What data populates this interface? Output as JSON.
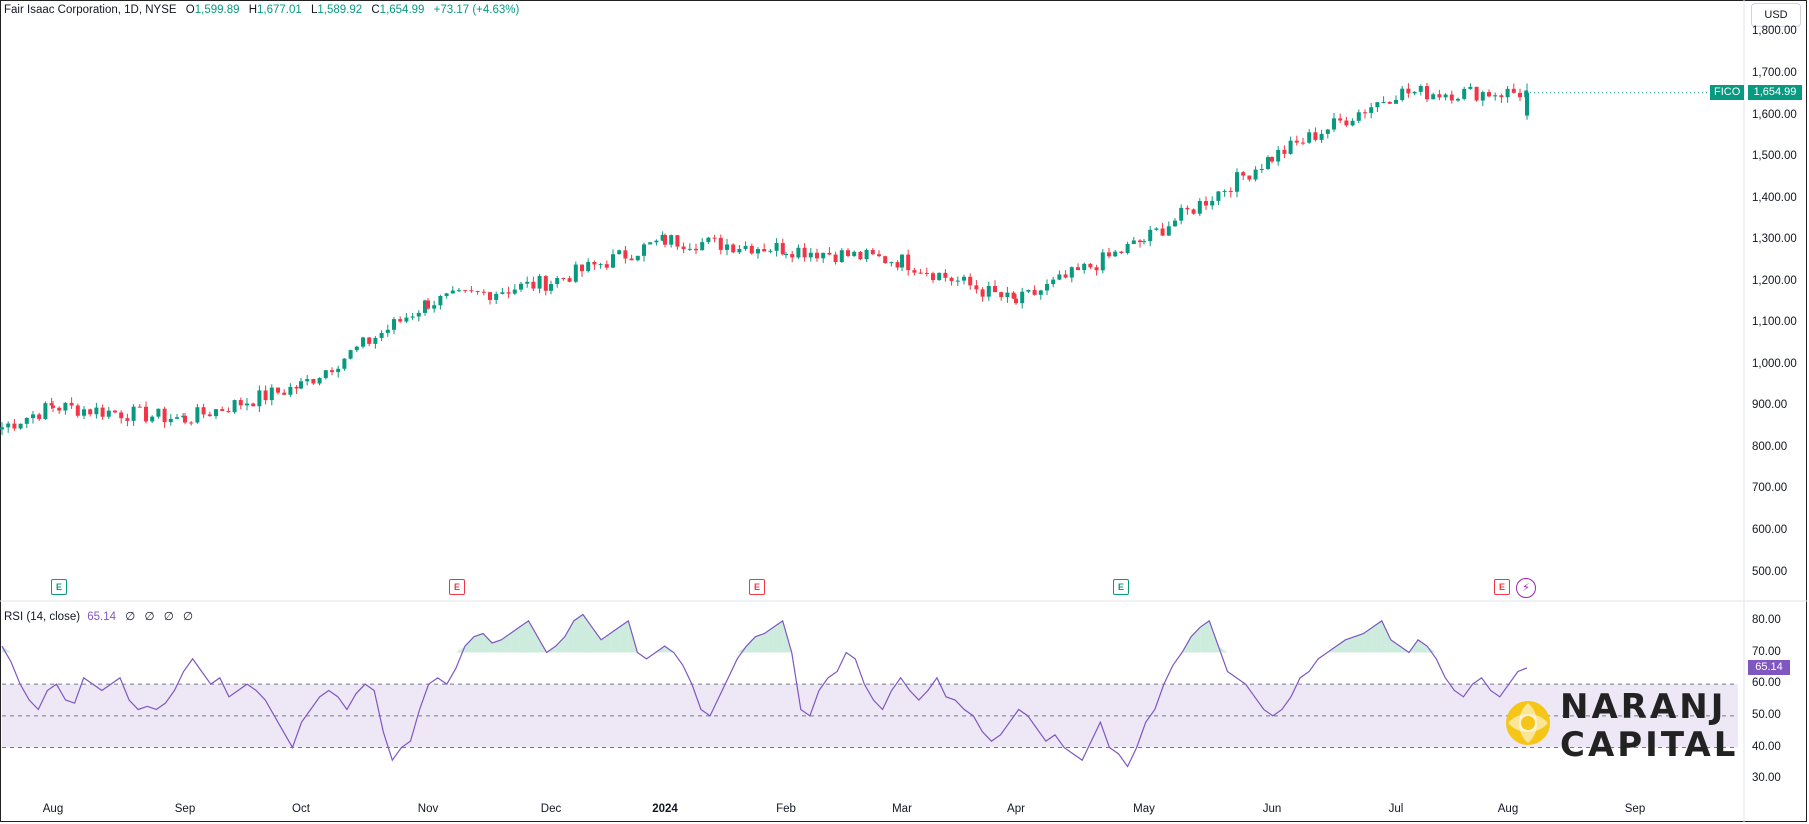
{
  "legend": {
    "symbol_title": "Fair Isaac Corporation, 1D, NYSE",
    "open_label": "O",
    "open": "1,599.89",
    "high_label": "H",
    "high": "1,677.01",
    "low_label": "L",
    "low": "1,589.92",
    "close_label": "C",
    "close": "1,654.99",
    "change": "+73.17 (+4.63%)"
  },
  "currency": "USD",
  "symbol": "FICO",
  "last_price": "1,654.99",
  "rsi": {
    "label": "RSI (14, close)",
    "value": "65.14",
    "extras": [
      "∅",
      "∅",
      "∅",
      "∅"
    ],
    "last_label": "65.14"
  },
  "price_axis": [
    "1,800.00",
    "1,700.00",
    "1,600.00",
    "1,500.00",
    "1,400.00",
    "1,300.00",
    "1,200.00",
    "1,100.00",
    "1,000.00",
    "900.00",
    "800.00",
    "700.00",
    "600.00",
    "500.00"
  ],
  "rsi_axis": [
    "80.00",
    "70.00",
    "60.00",
    "50.00",
    "40.00",
    "30.00"
  ],
  "time_axis": [
    {
      "label": "Aug",
      "bold": false
    },
    {
      "label": "Sep",
      "bold": false
    },
    {
      "label": "Oct",
      "bold": false
    },
    {
      "label": "Nov",
      "bold": false
    },
    {
      "label": "Dec",
      "bold": false
    },
    {
      "label": "2024",
      "bold": true
    },
    {
      "label": "Feb",
      "bold": false
    },
    {
      "label": "Mar",
      "bold": false
    },
    {
      "label": "Apr",
      "bold": false
    },
    {
      "label": "May",
      "bold": false
    },
    {
      "label": "Jun",
      "bold": false
    },
    {
      "label": "Jul",
      "bold": false
    },
    {
      "label": "Aug",
      "bold": false
    },
    {
      "label": "Sep",
      "bold": false
    }
  ],
  "events": [
    {
      "label": "E",
      "kind": "positive"
    },
    {
      "label": "E",
      "kind": "negative"
    },
    {
      "label": "E",
      "kind": "negative"
    },
    {
      "label": "E",
      "kind": "positive"
    },
    {
      "label": "E",
      "kind": "negative"
    }
  ],
  "dividend_icon": "lightning-icon",
  "logo": {
    "line1": "NARANJ",
    "line2": "CAPITAL"
  },
  "colors": {
    "up": "#089981",
    "down": "#f23645",
    "rsi": "#7e57c2",
    "rsi_band": "#ede7f6"
  },
  "chart_data": {
    "type": "candlestick",
    "price_series": {
      "name": "FICO",
      "ylim": [
        470,
        1830
      ],
      "anchors_month_close": [
        {
          "x": "Aug 2023",
          "close": 850
        },
        {
          "x": "Sep 2023",
          "close": 900
        },
        {
          "x": "Oct 2023",
          "close": 870
        },
        {
          "x": "Nov 2023",
          "close": 950
        },
        {
          "x": "Dec 2023",
          "close": 1150
        },
        {
          "x": "Jan 2024",
          "close": 1200
        },
        {
          "x": "Feb 2024",
          "close": 1300
        },
        {
          "x": "Mar 2024",
          "close": 1280
        },
        {
          "x": "Apr 2024",
          "close": 1250
        },
        {
          "x": "May 2024",
          "close": 1150
        },
        {
          "x": "Jun 2024",
          "close": 1300
        },
        {
          "x": "Jul 2024",
          "close": 1500
        },
        {
          "x": "Aug 2024",
          "close": 1655
        }
      ],
      "last": {
        "open": 1599.89,
        "high": 1677.01,
        "low": 1589.92,
        "close": 1654.99
      }
    },
    "rsi_series": {
      "name": "RSI (14, close)",
      "ylim": [
        25,
        85
      ],
      "bands": [
        30,
        40,
        50,
        60,
        70,
        80
      ],
      "dashed_levels": [
        40,
        50,
        60
      ],
      "values": [
        72,
        67,
        60,
        55,
        52,
        58,
        60,
        55,
        54,
        62,
        60,
        58,
        60,
        62,
        55,
        52,
        53,
        52,
        54,
        58,
        64,
        68,
        64,
        60,
        62,
        56,
        58,
        60,
        58,
        55,
        50,
        45,
        40,
        48,
        52,
        56,
        58,
        56,
        52,
        57,
        60,
        58,
        45,
        36,
        40,
        42,
        52,
        60,
        62,
        60,
        65,
        72,
        75,
        76,
        73,
        74,
        76,
        78,
        80,
        75,
        70,
        72,
        75,
        80,
        82,
        78,
        74,
        76,
        78,
        80,
        70,
        68,
        70,
        72,
        70,
        66,
        60,
        52,
        50,
        56,
        62,
        68,
        72,
        75,
        76,
        78,
        80,
        70,
        52,
        50,
        58,
        62,
        64,
        70,
        68,
        60,
        55,
        52,
        58,
        62,
        58,
        55,
        58,
        62,
        56,
        55,
        52,
        50,
        45,
        42,
        44,
        48,
        52,
        50,
        46,
        42,
        44,
        40,
        38,
        36,
        42,
        48,
        40,
        38,
        34,
        40,
        48,
        52,
        60,
        66,
        70,
        75,
        78,
        80,
        72,
        64,
        62,
        60,
        56,
        52,
        50,
        52,
        56,
        62,
        64,
        68,
        70,
        72,
        74,
        75,
        76,
        78,
        80,
        74,
        72,
        70,
        74,
        72,
        68,
        62,
        58,
        56,
        60,
        62,
        58,
        56,
        60,
        64,
        65.14
      ]
    },
    "x_range": [
      "Jul 2023",
      "Sep 2024"
    ]
  }
}
